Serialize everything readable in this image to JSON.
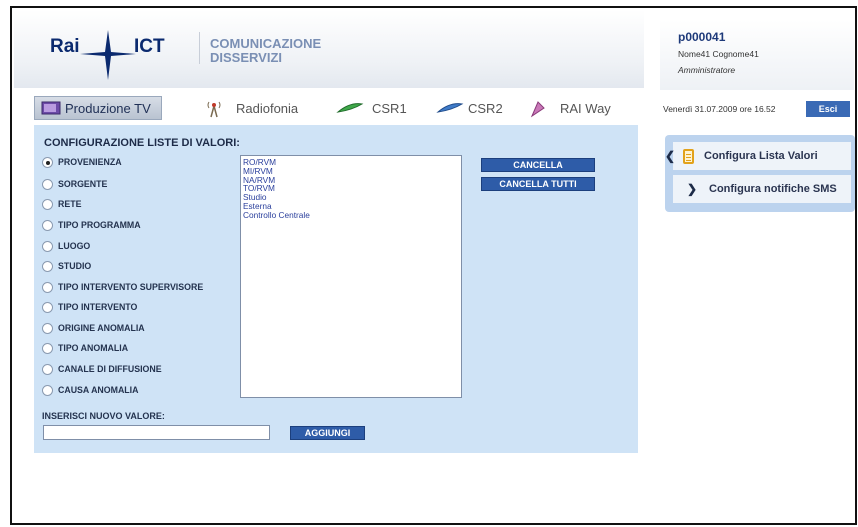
{
  "header": {
    "logo_rai": "Rai",
    "logo_ict": "ICT",
    "app_title_line1": "COMUNICAZIONE",
    "app_title_line2": "DISSERVIZI"
  },
  "user": {
    "id": "p000041",
    "name": "Nome41 Cognome41",
    "role": "Amministratore"
  },
  "tabs": [
    {
      "label": "Produzione TV",
      "icon": "tv-icon",
      "active": true
    },
    {
      "label": "Radiofonia",
      "icon": "radio-antenna-icon",
      "active": false
    },
    {
      "label": "CSR1",
      "icon": "satellite-dish-icon",
      "active": false
    },
    {
      "label": "CSR2",
      "icon": "satellite-dish-icon",
      "active": false
    },
    {
      "label": "RAI Way",
      "icon": "raiway-icon",
      "active": false
    }
  ],
  "datetime": "Venerdì 31.07.2009 ore 16.52",
  "logout_label": "Esci",
  "panel": {
    "title": "CONFIGURAZIONE LISTE DI VALORI:",
    "options": [
      {
        "label": "PROVENIENZA",
        "checked": true
      },
      {
        "label": "SORGENTE",
        "checked": false
      },
      {
        "label": "RETE",
        "checked": false
      },
      {
        "label": "TIPO PROGRAMMA",
        "checked": false
      },
      {
        "label": "LUOGO",
        "checked": false
      },
      {
        "label": "STUDIO",
        "checked": false
      },
      {
        "label": "TIPO INTERVENTO SUPERVISORE",
        "checked": false
      },
      {
        "label": "TIPO INTERVENTO",
        "checked": false
      },
      {
        "label": "ORIGINE ANOMALIA",
        "checked": false
      },
      {
        "label": "TIPO ANOMALIA",
        "checked": false
      },
      {
        "label": "CANALE DI DIFFUSIONE",
        "checked": false
      },
      {
        "label": "CAUSA ANOMALIA",
        "checked": false
      }
    ],
    "values": [
      "RO/RVM",
      "MI/RVM",
      "NA/RVM",
      "TO/RVM",
      "Studio",
      "Esterna",
      "Controllo Centrale"
    ],
    "delete_label": "CANCELLA",
    "delete_all_label": "CANCELLA TUTTI",
    "new_value_label": "INSERISCI NUOVO VALORE:",
    "new_value": "",
    "add_label": "AGGIUNGI"
  },
  "side_menu": [
    {
      "label": "Configura Lista Valori",
      "icon": "document-list-icon"
    },
    {
      "label": "Configura notifiche SMS",
      "icon": "chevron-right-icon"
    }
  ],
  "colors": {
    "panel_bg": "#cfe3f6",
    "button_bg": "#2e5ca8",
    "list_text": "#2a3f9c"
  }
}
